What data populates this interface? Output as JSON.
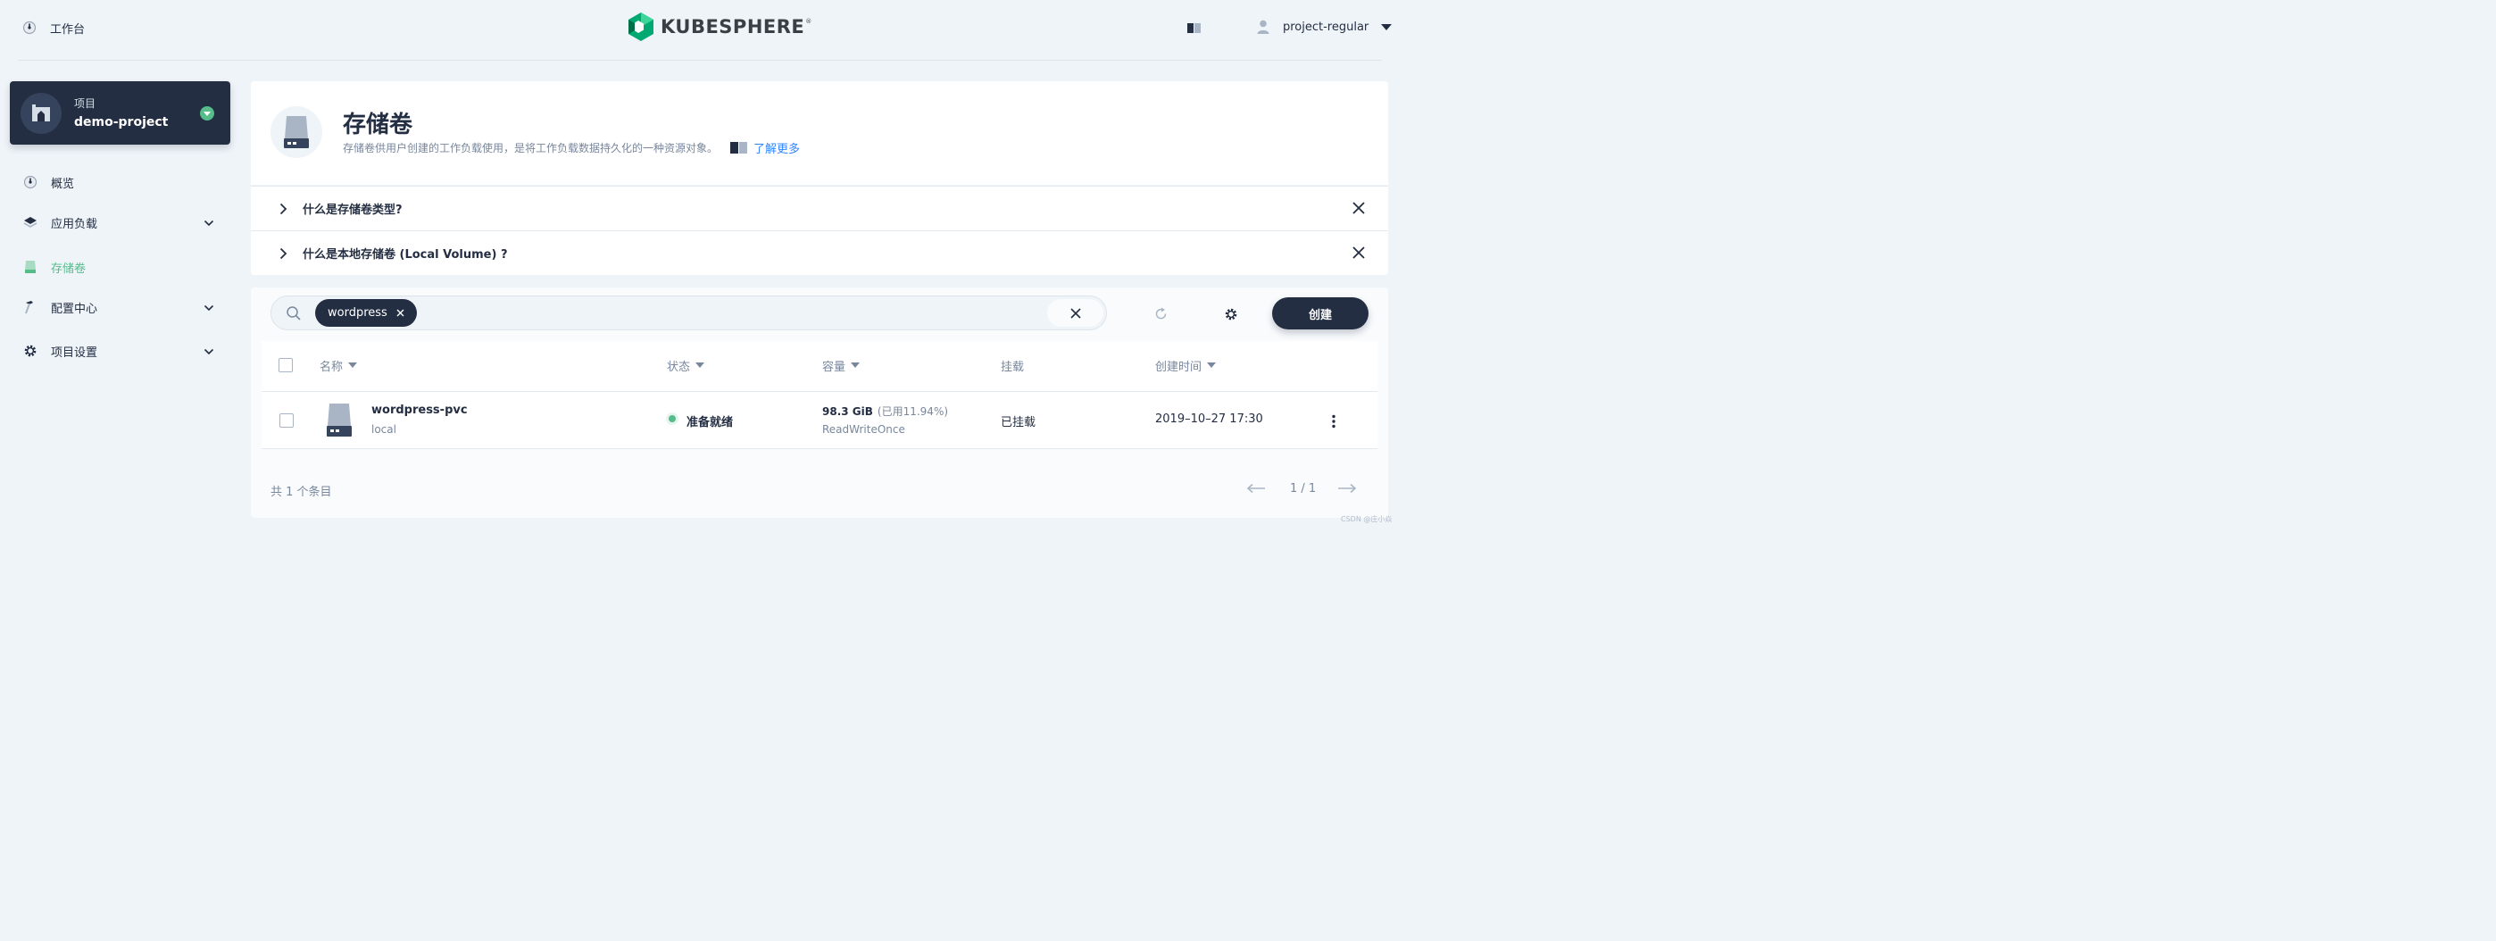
{
  "header": {
    "workbench_label": "工作台",
    "brand_name": "KUBESPHERE",
    "username": "project-regular"
  },
  "sidebar": {
    "project_type": "项目",
    "project_name": "demo-project",
    "items": [
      {
        "label": "概览",
        "icon": "dashboard-icon",
        "expandable": false,
        "active": false
      },
      {
        "label": "应用负载",
        "icon": "layers-icon",
        "expandable": true,
        "active": false
      },
      {
        "label": "存储卷",
        "icon": "storage-icon",
        "expandable": false,
        "active": true
      },
      {
        "label": "配置中心",
        "icon": "hammer-icon",
        "expandable": true,
        "active": false
      },
      {
        "label": "项目设置",
        "icon": "gear-icon",
        "expandable": true,
        "active": false
      }
    ]
  },
  "banner": {
    "title": "存储卷",
    "description": "存储卷供用户创建的工作负载使用，是将工作负载数据持久化的一种资源对象。",
    "learn_more": "了解更多"
  },
  "faq": [
    {
      "question": "什么是存储卷类型?"
    },
    {
      "question": "什么是本地存储卷 (Local Volume) ?"
    }
  ],
  "toolbar": {
    "filter_tag": "wordpress",
    "create_label": "创建"
  },
  "table": {
    "columns": [
      "名称",
      "状态",
      "容量",
      "挂载",
      "创建时间"
    ],
    "rows": [
      {
        "name": "wordpress-pvc",
        "storage_class": "local",
        "status": "准备就绪",
        "capacity": "98.3 GiB",
        "usage": "(已用11.94%)",
        "access_mode": "ReadWriteOnce",
        "mount": "已挂载",
        "created": "2019–10–27 17:30"
      }
    ]
  },
  "footer": {
    "total": "共 1 个条目",
    "page": "1 / 1"
  },
  "watermark": "CSDN @庄小焱",
  "colors": {
    "accent_green": "#55bc8a",
    "dark": "#242e42",
    "muted": "#79879c",
    "link_blue": "#3385ff"
  }
}
